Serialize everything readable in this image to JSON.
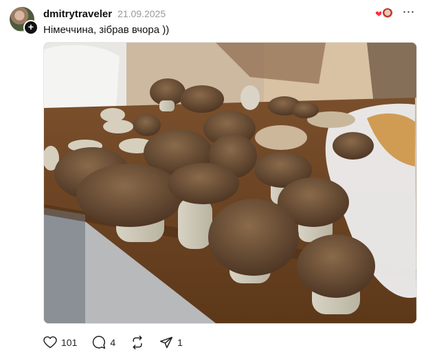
{
  "post": {
    "username": "dmitrytraveler",
    "timestamp": "21.09.2025",
    "caption": "Німеччина, зібрав вчора ))",
    "image": {
      "subject": "mushrooms-on-wooden-table"
    },
    "stats": {
      "likes": "101",
      "comments": "4",
      "shares": "1"
    },
    "icons": {
      "follow": "plus-icon",
      "reaction": "heart-icon",
      "more": "more-horizontal-icon",
      "like": "heart-outline-icon",
      "comment": "comment-icon",
      "repost": "repost-icon",
      "share": "send-icon"
    },
    "colors": {
      "heart": "#ff3040",
      "text": "#101010",
      "muted": "#999999"
    }
  }
}
